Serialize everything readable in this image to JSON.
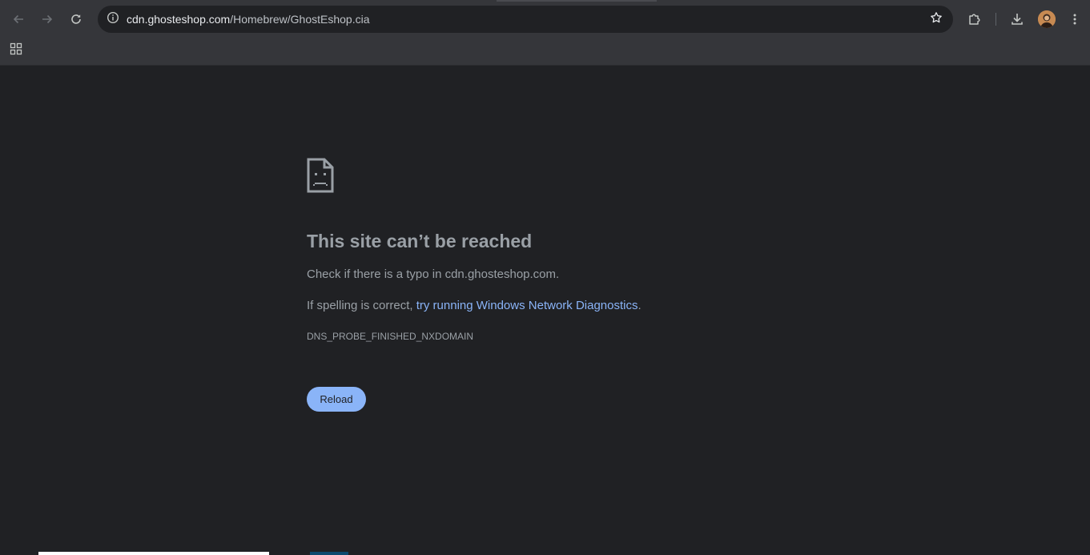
{
  "browser": {
    "url_host": "cdn.ghosteshop.com",
    "url_path": "/Homebrew/GhostEshop.cia",
    "icons": {
      "back": "back-arrow-icon",
      "forward": "forward-arrow-icon",
      "reload": "reload-icon",
      "site_info": "site-info-icon",
      "bookmark": "star-icon",
      "extensions": "puzzle-icon",
      "downloads": "download-icon",
      "menu": "kebab-menu-icon",
      "apps": "apps-grid-icon"
    },
    "colors": {
      "toolbar": "#35363a",
      "omnibox": "#202124",
      "page_bg": "#202124",
      "link": "#8ab4f8"
    }
  },
  "error": {
    "icon": "sad-page-icon",
    "headline": "This site can’t be reached",
    "typo_prefix": "Check if there is a typo in ",
    "typo_host": "cdn.ghosteshop.com",
    "typo_suffix": ".",
    "spelling_prefix": "If spelling is correct, ",
    "diagnostics_link": "try running Windows Network Diagnostics",
    "spelling_suffix": ".",
    "error_code": "DNS_PROBE_FINISHED_NXDOMAIN",
    "reload_label": "Reload"
  }
}
